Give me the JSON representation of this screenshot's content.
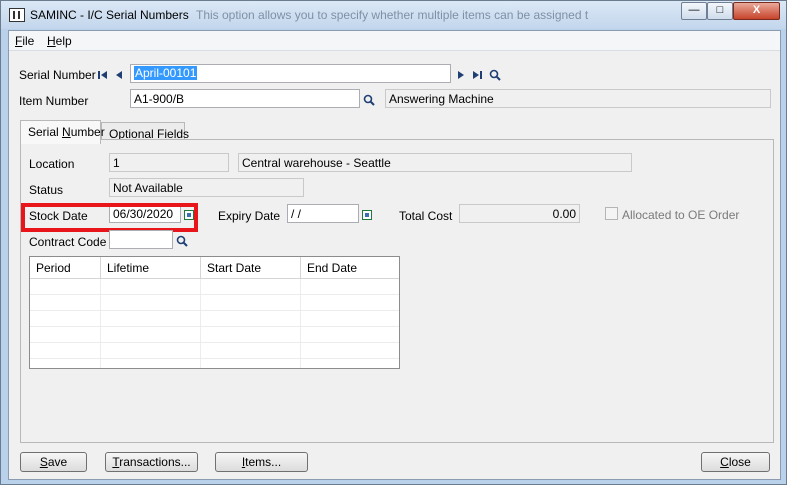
{
  "window": {
    "title": "SAMINC - I/C Serial Numbers",
    "background_title": "This option allows you to specify whether multiple items can be assigned t",
    "controls": {
      "minimize": "—",
      "maximize": "□",
      "close": "X"
    }
  },
  "menu": [
    {
      "key": "F",
      "rest": "ile"
    },
    {
      "key": "H",
      "rest": "elp"
    }
  ],
  "header": {
    "serial_number_label": "Serial Number",
    "serial_number_value": "April-00101",
    "item_number_label": "Item Number",
    "item_number_value": "A1-900/B",
    "item_description": "Answering Machine"
  },
  "tabs": [
    {
      "label": "Serial Number",
      "key_index": 7,
      "active": true
    },
    {
      "label": "Optional Fields",
      "key_index": 0,
      "active": false
    }
  ],
  "details": {
    "location_label": "Location",
    "location_code": "1",
    "location_name": "Central warehouse - Seattle",
    "status_label": "Status",
    "status_value": "Not Available",
    "stock_date_label": "Stock Date",
    "stock_date_value": "06/30/2020",
    "expiry_date_label": "Expiry Date",
    "expiry_date_value": " / /",
    "total_cost_label": "Total Cost",
    "total_cost_value": "0.00",
    "allocated_label": "Allocated to OE Order",
    "contract_code_label": "Contract Code",
    "contract_code_value": ""
  },
  "grid": {
    "columns": [
      "Period",
      "Lifetime",
      "Start Date",
      "End Date"
    ],
    "rows": []
  },
  "buttons": {
    "save": {
      "key": "S",
      "rest": "ave"
    },
    "transactions": {
      "key": "T",
      "rest": "ransactions..."
    },
    "items": {
      "key": "I",
      "rest": "tems..."
    },
    "close": {
      "key": "C",
      "rest": "lose"
    }
  },
  "colors": {
    "highlight": "#e8161b",
    "selection": "#3399ff",
    "calendar_icon": "#1e7a3c",
    "nav_icon": "#1f3f74"
  }
}
